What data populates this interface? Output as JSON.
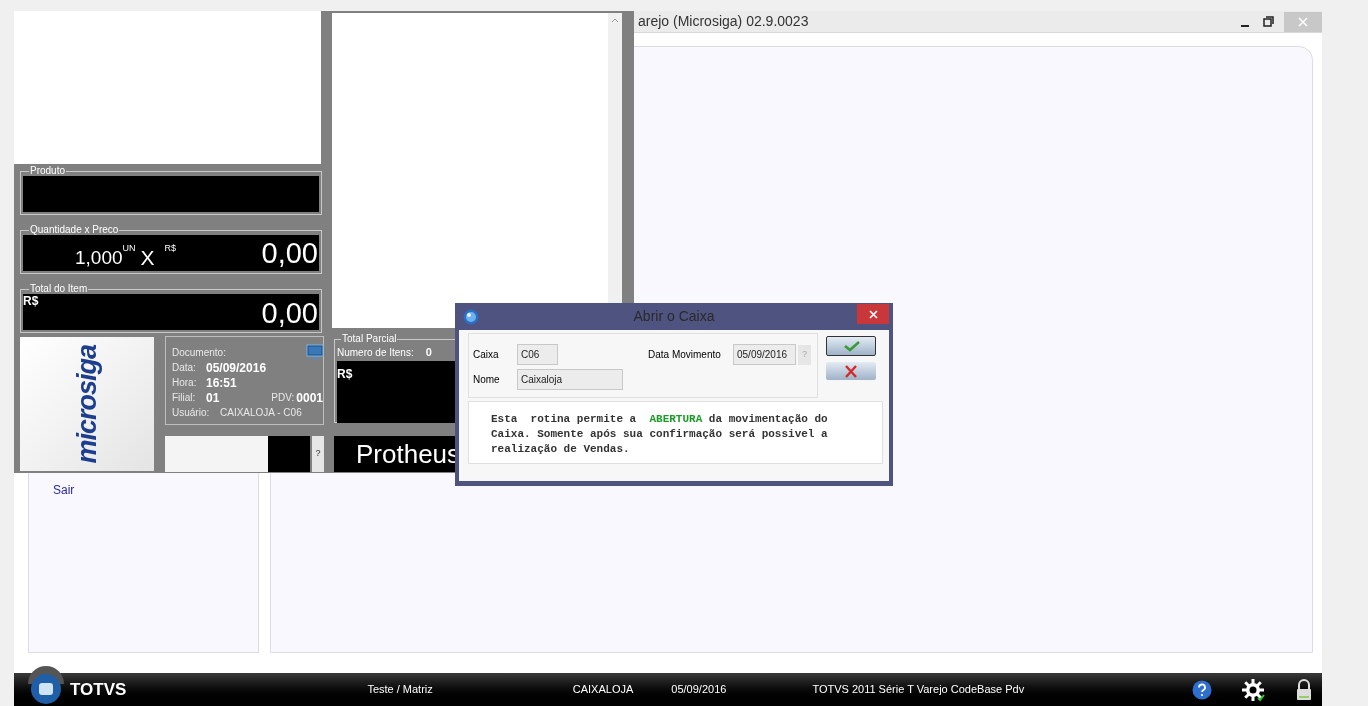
{
  "main_window": {
    "title": "arejo (Microsiga) 02.9.0023",
    "menu_items": [
      {
        "label": "Sair"
      }
    ]
  },
  "pos": {
    "produto": {
      "label": "Produto"
    },
    "quantidade": {
      "label": "Quantidade x Preco",
      "qty": "1,000",
      "unit": "UN",
      "times": "X",
      "currency": "R$",
      "price": "0,00"
    },
    "total_item": {
      "label": "Total do Item",
      "currency": "R$",
      "value": "0,00"
    },
    "logo": "microsiga",
    "info": {
      "title": "Documento:",
      "rows": [
        {
          "label": "Data:",
          "value": "05/09/2016"
        },
        {
          "label": "Hora:",
          "value": "16:51"
        },
        {
          "label": "Filial:",
          "value": "01",
          "extra_label": "PDV:",
          "extra_value": "0001"
        }
      ],
      "user_label": "Usuário:",
      "user_value": "CAIXALOJA - C06"
    },
    "help_button": "?",
    "total_parcial": {
      "label": "Total Parcial",
      "items_label": "Numero de Itens:",
      "items_value": "0",
      "currency": "R$"
    },
    "brand": "Protheus"
  },
  "dialog": {
    "title": "Abrir o Caixa",
    "fields": [
      {
        "label": "Caixa",
        "value": "C06"
      },
      {
        "label": "Nome",
        "value": "Caixaloja"
      },
      {
        "label": "Data Movimento",
        "value": "05/09/2016"
      }
    ],
    "help_button": "?",
    "message": {
      "before": "Esta  rotina permite a  ",
      "highlight": "ABERTURA",
      "after": " da movimentação do\nCaixa. Somente após sua confirmação será possivel a\nrealização de Vendas."
    }
  },
  "footer": {
    "logo": "TOTVS",
    "items": [
      "Teste / Matriz",
      "CAIXALOJA",
      "05/09/2016",
      "TOTVS 2011 Série T Varejo CodeBase Pdv"
    ]
  }
}
